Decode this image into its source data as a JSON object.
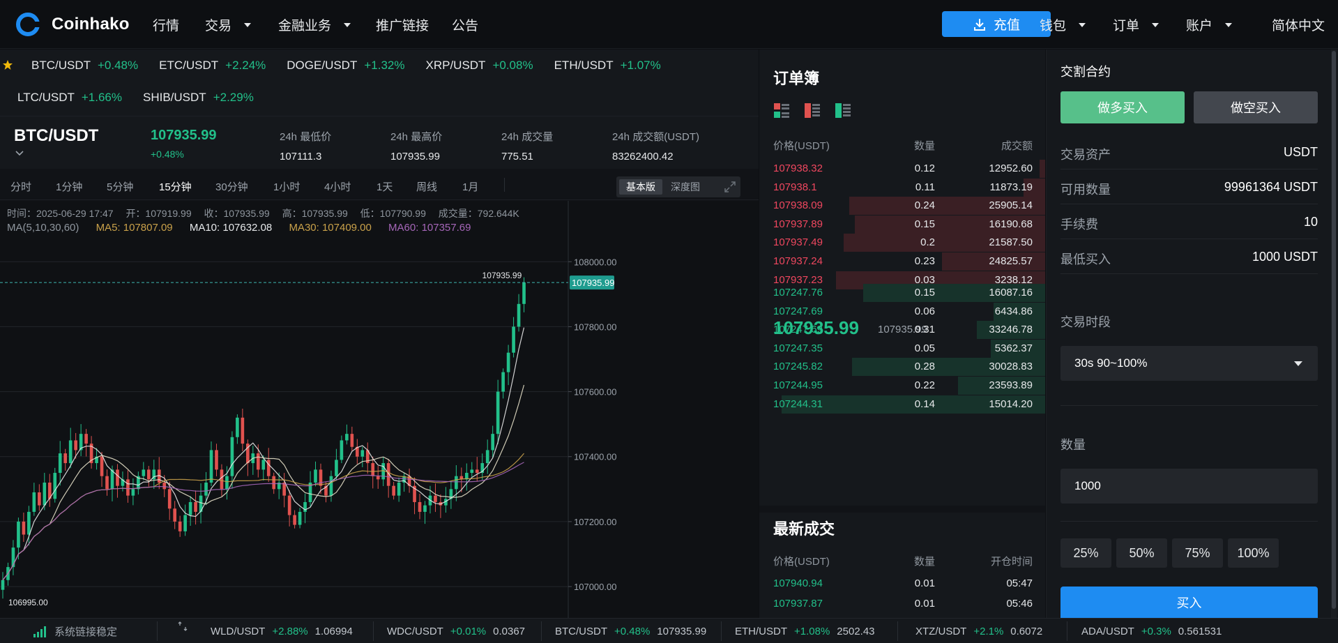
{
  "brand": {
    "name": "Coinhako",
    "accent": "#1e8cf2"
  },
  "nav": {
    "items": [
      {
        "label": "行情",
        "dropdown": false
      },
      {
        "label": "交易",
        "dropdown": true
      },
      {
        "label": "金融业务",
        "dropdown": true
      },
      {
        "label": "推广链接",
        "dropdown": false
      },
      {
        "label": "公告",
        "dropdown": false
      }
    ],
    "deposit": "充值",
    "right": [
      {
        "label": "钱包",
        "dropdown": true
      },
      {
        "label": "订单",
        "dropdown": true
      },
      {
        "label": "账户",
        "dropdown": true
      },
      {
        "label": "简体中文",
        "dropdown": false
      }
    ]
  },
  "favorites": {
    "row1": [
      {
        "symbol": "BTC/USDT",
        "change": "+0.48%"
      },
      {
        "symbol": "ETC/USDT",
        "change": "+2.24%"
      },
      {
        "symbol": "DOGE/USDT",
        "change": "+1.32%"
      },
      {
        "symbol": "XRP/USDT",
        "change": "+0.08%"
      },
      {
        "symbol": "ETH/USDT",
        "change": "+1.07%"
      }
    ],
    "row2": [
      {
        "symbol": "LTC/USDT",
        "change": "+1.66%"
      },
      {
        "symbol": "SHIB/USDT",
        "change": "+2.29%"
      }
    ]
  },
  "ticker": {
    "pair": "BTC/USDT",
    "price": "107935.99",
    "change": "+0.48%",
    "stats": [
      {
        "label": "24h 最低价",
        "value": "107111.3"
      },
      {
        "label": "24h 最高价",
        "value": "107935.99"
      },
      {
        "label": "24h 成交量",
        "value": "775.51"
      },
      {
        "label": "24h 成交额(USDT)",
        "value": "83262400.42"
      }
    ]
  },
  "intervals": {
    "items": [
      "分时",
      "1分钟",
      "5分钟",
      "15分钟",
      "30分钟",
      "1小时",
      "4小时",
      "1天",
      "周线",
      "1月"
    ],
    "active": "15分钟",
    "views": [
      "基本版",
      "深度图"
    ],
    "active_view": "基本版"
  },
  "chart_info": {
    "time": "时间：2025-06-29 17:47",
    "open": "开：107919.99",
    "close": "收：107935.99",
    "high": "高：107935.99",
    "low": "低：107790.99",
    "volume": "成交量：792.644K",
    "ma_label": "MA(5,10,30,60)",
    "ma5": "MA5: 107807.09",
    "ma10": "MA10: 107632.08",
    "ma30": "MA30: 107409.00",
    "ma60": "MA60: 107357.69",
    "last_label": "107935.99",
    "last_tag": "107935.99",
    "low_label": "106995.00"
  },
  "chart_data": {
    "type": "candlestick",
    "y_ticks": [
      "108000.00",
      "107800.00",
      "107600.00",
      "107400.00",
      "107200.00",
      "107000.00"
    ],
    "ylim": [
      106925,
      108080
    ],
    "colors": {
      "up": "#22c08a",
      "down": "#e0524f",
      "ma5": "#e8e8e8",
      "ma10": "#e6e0c8",
      "ma30": "#c9a14a",
      "ma60": "#a566b8"
    },
    "last_price": 107935.99,
    "closes": [
      107020,
      107060,
      107120,
      107200,
      107160,
      107230,
      107290,
      107250,
      107320,
      107270,
      107350,
      107410,
      107380,
      107450,
      107420,
      107470,
      107440,
      107380,
      107400,
      107340,
      107300,
      107360,
      107310,
      107330,
      107280,
      107300,
      107340,
      107360,
      107330,
      107360,
      107320,
      107300,
      107240,
      107200,
      107170,
      107220,
      107260,
      107230,
      107280,
      107320,
      107420,
      107360,
      107300,
      107340,
      107460,
      107520,
      107440,
      107380,
      107410,
      107360,
      107390,
      107340,
      107300,
      107320,
      107280,
      107220,
      107190,
      107230,
      107260,
      107320,
      107360,
      107310,
      107280,
      107340,
      107390,
      107450,
      107470,
      107430,
      107400,
      107420,
      107380,
      107340,
      107330,
      107380,
      107310,
      107280,
      107320,
      107340,
      107310,
      107260,
      107230,
      107250,
      107280,
      107260,
      107250,
      107270,
      107300,
      107340,
      107330,
      107350,
      107360,
      107350,
      107380,
      107420,
      107470,
      107600,
      107660,
      107720,
      107800,
      107870,
      107935.99
    ]
  },
  "orderbook": {
    "title": "订单簿",
    "headers": [
      "价格(USDT)",
      "数量",
      "成交额"
    ],
    "asks": [
      {
        "price": "107938.32",
        "qty": "0.12",
        "total": "12952.60",
        "depth": 0.02
      },
      {
        "price": "107938.1",
        "qty": "0.11",
        "total": "11873.19",
        "depth": 0.08
      },
      {
        "price": "107938.09",
        "qty": "0.24",
        "total": "25905.14",
        "depth": 0.72
      },
      {
        "price": "107937.89",
        "qty": "0.15",
        "total": "16190.68",
        "depth": 0.7
      },
      {
        "price": "107937.49",
        "qty": "0.2",
        "total": "21587.50",
        "depth": 0.74
      },
      {
        "price": "107937.24",
        "qty": "0.23",
        "total": "24825.57",
        "depth": 0.38
      },
      {
        "price": "107937.23",
        "qty": "0.03",
        "total": "3238.12",
        "depth": 0.77
      }
    ],
    "mid_price": "107935.99",
    "mid_sub": "107935.99",
    "bids": [
      {
        "price": "107247.76",
        "qty": "0.15",
        "total": "16087.16",
        "depth": 0.67
      },
      {
        "price": "107247.69",
        "qty": "0.06",
        "total": "6434.86",
        "depth": 0.19
      },
      {
        "price": "107247.69",
        "qty": "0.31",
        "total": "33246.78",
        "depth": 0.25
      },
      {
        "price": "107247.35",
        "qty": "0.05",
        "total": "5362.37",
        "depth": 0.2
      },
      {
        "price": "107245.82",
        "qty": "0.28",
        "total": "30028.83",
        "depth": 0.71
      },
      {
        "price": "107244.95",
        "qty": "0.22",
        "total": "23593.89",
        "depth": 0.32
      },
      {
        "price": "107244.31",
        "qty": "0.14",
        "total": "15014.20",
        "depth": 0.97
      }
    ]
  },
  "trades": {
    "title": "最新成交",
    "headers": [
      "价格(USDT)",
      "数量",
      "开仓时间"
    ],
    "rows": [
      {
        "price": "107940.94",
        "qty": "0.01",
        "time": "05:47"
      },
      {
        "price": "107937.87",
        "qty": "0.01",
        "time": "05:46"
      }
    ]
  },
  "tradeform": {
    "title": "交割合约",
    "long": "做多买入",
    "short": "做空买入",
    "rows": [
      {
        "k": "交易资产",
        "v": "USDT"
      },
      {
        "k": "可用数量",
        "v": "99961364 USDT"
      },
      {
        "k": "手续费",
        "v": "10"
      },
      {
        "k": "最低买入",
        "v": "1000 USDT"
      }
    ],
    "period_label": "交易时段",
    "period_value": "30s 90~100%",
    "qty_label": "数量",
    "qty_value": "1000",
    "percents": [
      "25%",
      "50%",
      "75%",
      "100%"
    ],
    "buy": "买入"
  },
  "statusbar": {
    "connection": "系统链接稳定",
    "items": [
      {
        "symbol": "WLD/USDT",
        "change": "+2.88%",
        "price": "1.06994"
      },
      {
        "symbol": "WDC/USDT",
        "change": "+0.01%",
        "price": "0.0367"
      },
      {
        "symbol": "BTC/USDT",
        "change": "+0.48%",
        "price": "107935.99"
      },
      {
        "symbol": "ETH/USDT",
        "change": "+1.08%",
        "price": "2502.43"
      },
      {
        "symbol": "XTZ/USDT",
        "change": "+2.1%",
        "price": "0.6072"
      },
      {
        "symbol": "ADA/USDT",
        "change": "+0.3%",
        "price": "0.561531"
      }
    ]
  }
}
